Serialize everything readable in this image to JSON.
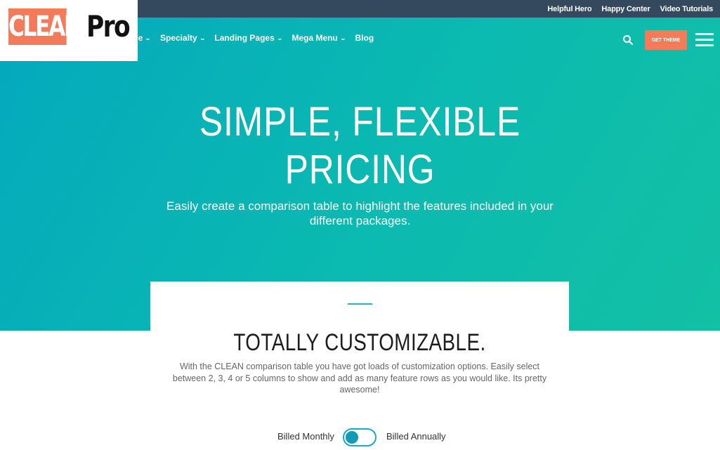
{
  "topbar": {
    "links": [
      "Helpful Hero",
      "Happy Center",
      "Video Tutorials"
    ]
  },
  "brand": {
    "clean": "CLEAN",
    "pro": "Pro",
    "accent_color": "#f47a5a"
  },
  "nav": {
    "partial_item": "e",
    "items": [
      "Specialty",
      "Landing Pages",
      "Mega Menu",
      "Blog"
    ]
  },
  "header": {
    "cta_label": "GET THEME",
    "search_icon": "search-icon",
    "menu_icon": "hamburger-icon"
  },
  "hero": {
    "title_line1": "SIMPLE, FLEXIBLE",
    "title_line2": "PRICING",
    "subtitle": "Easily create a comparison table to highlight the features included in your different packages.",
    "gradient_start": "#04a9bd",
    "gradient_end": "#13c0a4"
  },
  "section": {
    "title": "TOTALLY CUSTOMIZABLE.",
    "body": "With the CLEAN comparison table you have got loads of customization options. Easily select between 2, 3, 4 or 5 columns to show and add as many feature rows as you would like. Its pretty awesome!"
  },
  "billing": {
    "monthly_label": "Billed Monthly",
    "annually_label": "Billed Annually",
    "toggle_state": "monthly"
  }
}
